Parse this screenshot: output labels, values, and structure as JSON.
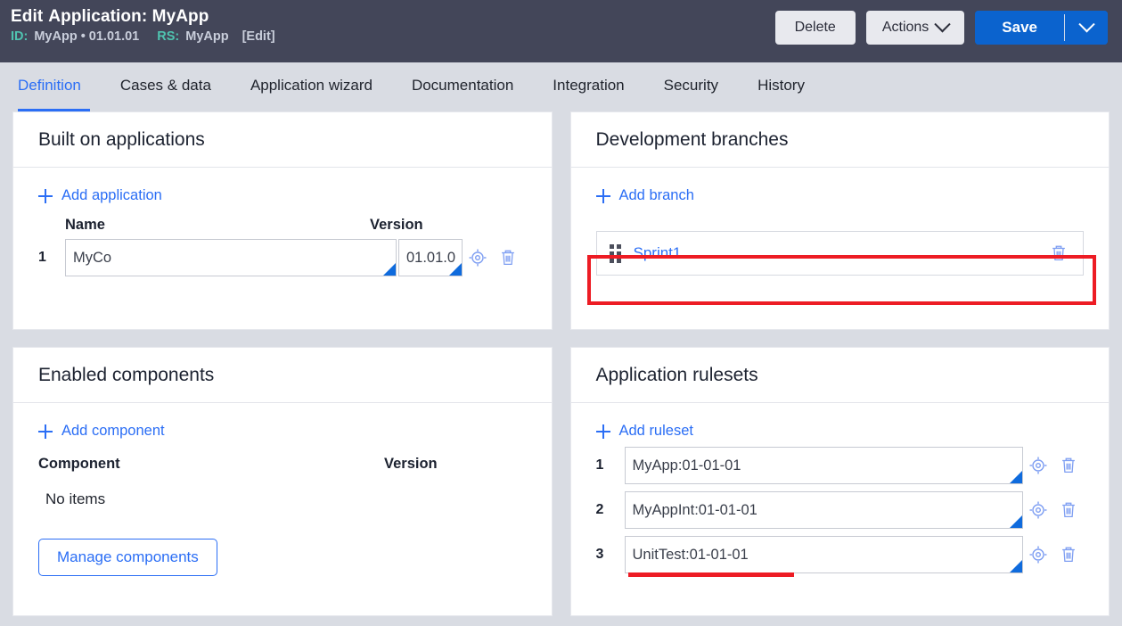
{
  "header": {
    "title_prefix": "Edit",
    "title": "Application: MyApp",
    "id_label": "ID:",
    "id_value": "MyApp • 01.01.01",
    "rs_label": "RS:",
    "rs_value": "MyApp",
    "edit_link": "[Edit]",
    "delete_label": "Delete",
    "actions_label": "Actions",
    "save_label": "Save"
  },
  "tabs": [
    {
      "label": "Definition",
      "active": true
    },
    {
      "label": "Cases & data",
      "active": false
    },
    {
      "label": "Application wizard",
      "active": false
    },
    {
      "label": "Documentation",
      "active": false
    },
    {
      "label": "Integration",
      "active": false
    },
    {
      "label": "Security",
      "active": false
    },
    {
      "label": "History",
      "active": false
    }
  ],
  "built_on": {
    "title": "Built on applications",
    "add_label": "Add application",
    "col_name": "Name",
    "col_version": "Version",
    "rows": [
      {
        "num": "1",
        "name": "MyCo",
        "version": "01.01.0"
      }
    ]
  },
  "branches": {
    "title": "Development branches",
    "add_label": "Add branch",
    "rows": [
      {
        "name": "Sprint1"
      }
    ]
  },
  "components": {
    "title": "Enabled components",
    "add_label": "Add component",
    "col_component": "Component",
    "col_version": "Version",
    "empty_text": "No items",
    "manage_label": "Manage components"
  },
  "rulesets": {
    "title": "Application rulesets",
    "add_label": "Add ruleset",
    "rows": [
      {
        "num": "1",
        "value": "MyApp:01-01-01"
      },
      {
        "num": "2",
        "value": "MyAppInt:01-01-01"
      },
      {
        "num": "3",
        "value": "UnitTest:01-01-01"
      }
    ]
  },
  "annotations": {
    "highlight_color": "#ed1c24",
    "branch_row_box": true,
    "ruleset_row3_underline": true
  },
  "colors": {
    "header_bg": "#434659",
    "page_bg": "#d9dce3",
    "accent_blue": "#2b6ef5",
    "primary_button": "#0b63ce",
    "meta_key": "#4fc3b0"
  }
}
